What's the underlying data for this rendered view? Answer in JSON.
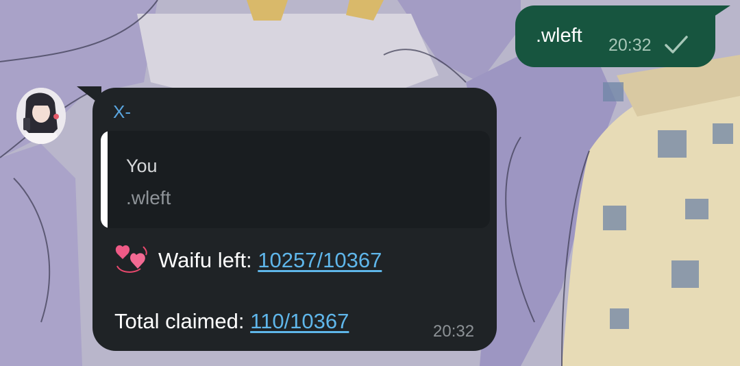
{
  "outgoing": {
    "text": ".wleft",
    "time": "20:32",
    "status_icon": "single-check-icon"
  },
  "incoming": {
    "sender": "X-",
    "avatar_icon": "user-avatar",
    "reply": {
      "author": "You",
      "text": ".wleft"
    },
    "lines": [
      {
        "emoji": "revolving-hearts-icon",
        "label": "Waifu left: ",
        "link": "10257/10367"
      },
      {
        "label": "Total claimed: ",
        "link": "110/10367"
      }
    ],
    "time": "20:32"
  },
  "colors": {
    "outgoing_bubble": "#17553f",
    "incoming_bubble": "#1f2326",
    "link": "#5fb6ea",
    "sender": "#5aa6e0"
  }
}
